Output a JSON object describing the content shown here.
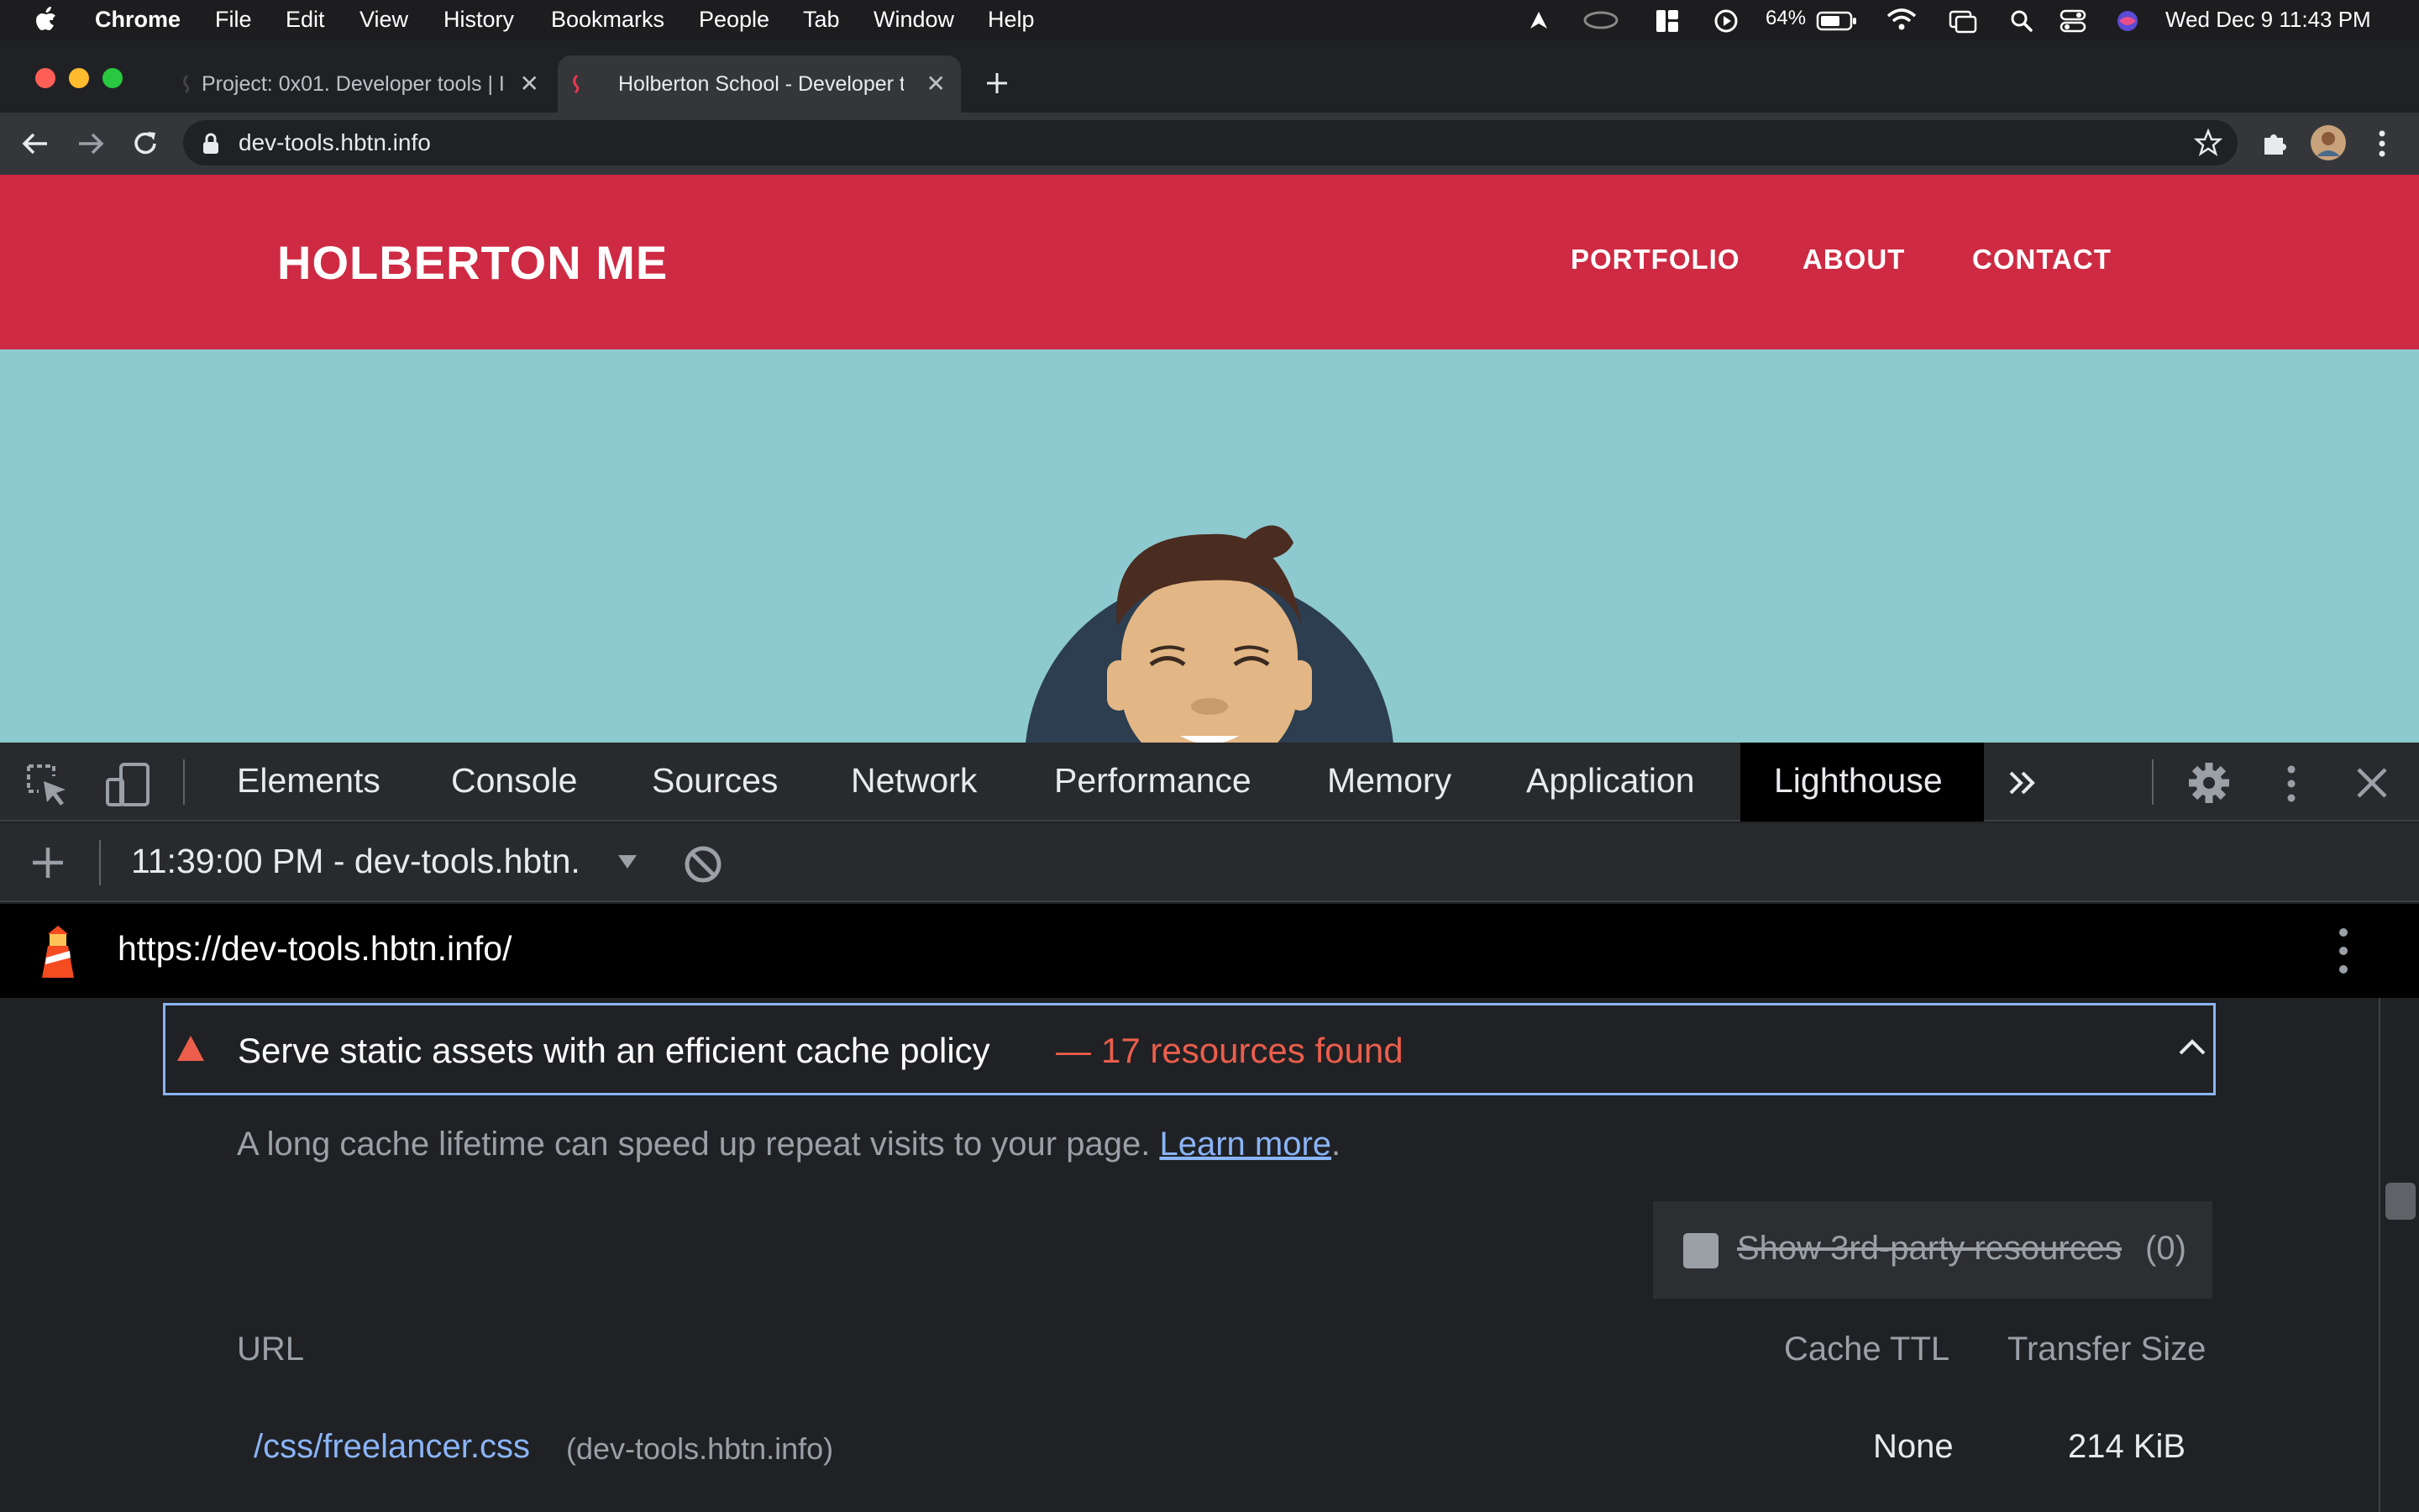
{
  "menubar": {
    "app": "Chrome",
    "items": [
      "File",
      "Edit",
      "View",
      "History",
      "Bookmarks",
      "People",
      "Tab",
      "Window",
      "Help"
    ],
    "battery": "64%",
    "clock": "Wed Dec 9  11:43 PM"
  },
  "tabs": [
    {
      "title": "Project: 0x01. Developer tools | I",
      "active": false
    },
    {
      "title": "Holberton School - Developer t",
      "active": true
    }
  ],
  "omnibox": {
    "url": "dev-tools.hbtn.info"
  },
  "site": {
    "brand": "HOLBERTON ME",
    "nav": [
      "PORTFOLIO",
      "ABOUT",
      "CONTACT"
    ]
  },
  "devtools": {
    "tabs": [
      "Elements",
      "Console",
      "Sources",
      "Network",
      "Performance",
      "Memory",
      "Application",
      "Lighthouse"
    ],
    "active_tab": "Lighthouse",
    "report_select": "11:39:00 PM - dev-tools.hbtn.",
    "report_url": "https://dev-tools.hbtn.info/"
  },
  "audit": {
    "title": "Serve static assets with an efficient cache policy",
    "separator": "—",
    "display_value": "17 resources found",
    "description": "A long cache lifetime can speed up repeat visits to your page.",
    "learn_more": "Learn more",
    "third_party_label": "Show 3rd-party resources",
    "third_party_count": "(0)",
    "columns": {
      "url": "URL",
      "ttl": "Cache TTL",
      "size": "Transfer Size"
    },
    "rows": [
      {
        "url": "/css/freelancer.css",
        "host": "(dev-tools.hbtn.info)",
        "ttl": "None",
        "size": "214 KiB"
      }
    ]
  },
  "colors": {
    "site_header": "#cf2a43",
    "site_hero": "#8dcad0",
    "warning": "#ec5e4c",
    "link": "#8ab4f8"
  }
}
